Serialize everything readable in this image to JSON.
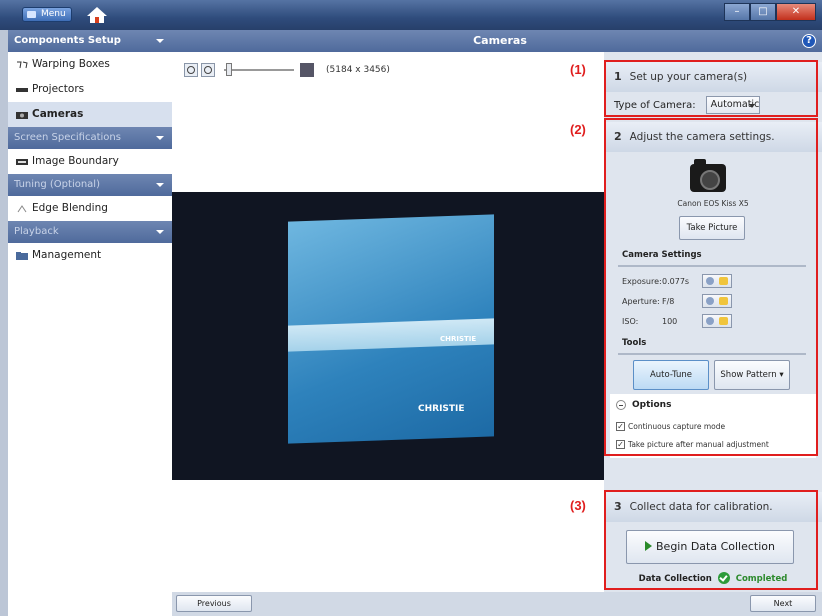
{
  "titlebar": {
    "menu_label": "Menu"
  },
  "sidebar": {
    "sections": [
      {
        "title": "Components Setup",
        "items": [
          "Warping Boxes",
          "Projectors",
          "Cameras"
        ]
      },
      {
        "title": "Screen Specifications",
        "items": [
          "Image Boundary"
        ]
      },
      {
        "title": "Tuning (Optional)",
        "items": [
          "Edge Blending"
        ]
      },
      {
        "title": "Playback",
        "items": [
          "Management"
        ]
      }
    ],
    "selected": "Cameras"
  },
  "center": {
    "title": "Cameras",
    "resolution": "(5184 x 3456)"
  },
  "screen": {
    "logo": "CHRISTIE"
  },
  "step1": {
    "num": "1",
    "title": "Set up your camera(s)",
    "type_label": "Type of Camera:",
    "type_value": "Automatic"
  },
  "step2": {
    "num": "2",
    "title": "Adjust the camera settings.",
    "camera_name": "Canon EOS Kiss X5",
    "take_picture": "Take Picture",
    "camera_settings_label": "Camera Settings",
    "settings": [
      {
        "label": "Exposure:",
        "value": "0.077s"
      },
      {
        "label": "Aperture:",
        "value": "F/8"
      },
      {
        "label": "ISO:",
        "value": "100"
      }
    ],
    "tools_label": "Tools",
    "auto_tune": "Auto-Tune",
    "show_pattern": "Show Pattern",
    "options_label": "Options",
    "options": [
      "Continuous capture mode",
      "Take picture after manual adjustment"
    ]
  },
  "step3": {
    "num": "3",
    "title": "Collect data for calibration.",
    "begin": "Begin Data Collection",
    "status_label": "Data Collection",
    "status_value": "Completed"
  },
  "annotations": [
    "(1)",
    "(2)",
    "(3)"
  ],
  "nav": {
    "previous": "Previous",
    "next": "Next"
  },
  "colors": {
    "highlight": "#e01e1e",
    "header": "#4f6a9c",
    "completed": "#2d8a2d"
  }
}
